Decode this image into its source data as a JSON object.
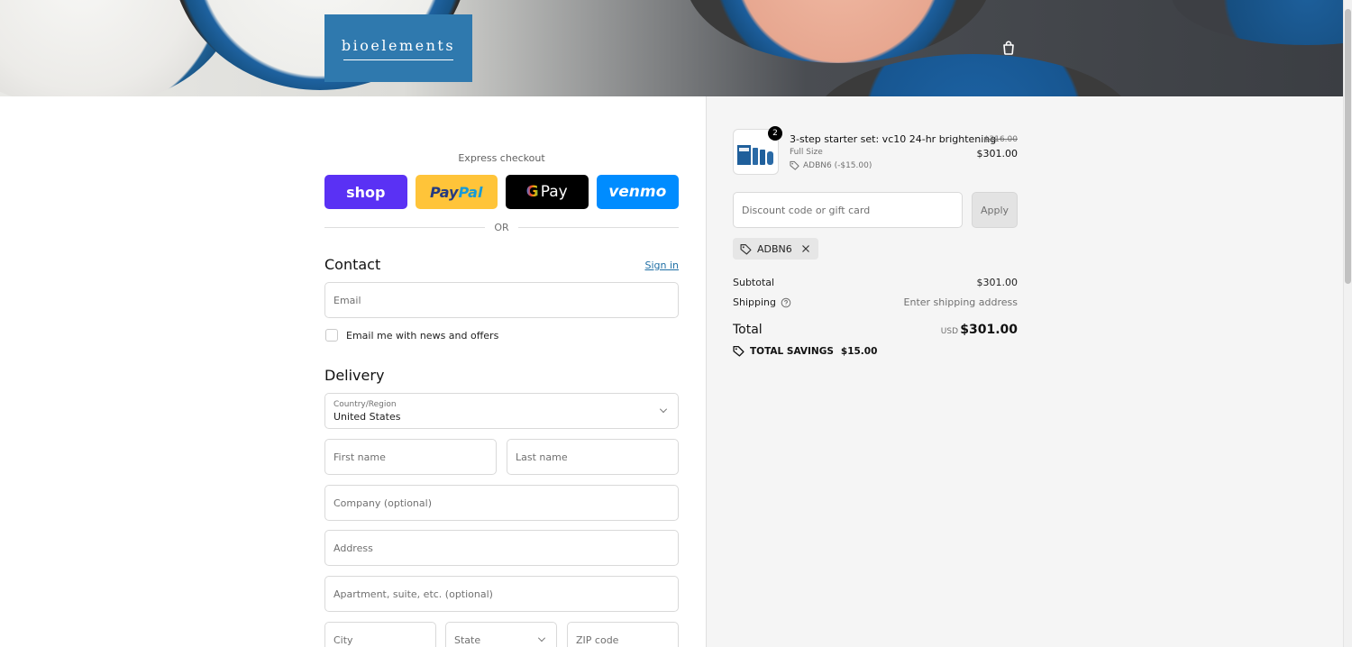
{
  "brand": {
    "logo_text": "bioelements"
  },
  "express": {
    "title": "Express checkout",
    "or_label": "OR",
    "buttons": {
      "shop": "shop",
      "paypal_pay": "Pay",
      "paypal_pal": "Pal",
      "gpay_g": "G",
      "gpay_pay": "Pay",
      "venmo": "venmo"
    }
  },
  "contact": {
    "title": "Contact",
    "signin_label": "Sign in",
    "email_placeholder": "Email",
    "newsletter_label": "Email me with news and offers"
  },
  "delivery": {
    "title": "Delivery",
    "country_label": "Country/Region",
    "country_value": "United States",
    "first_name_placeholder": "First name",
    "last_name_placeholder": "Last name",
    "company_placeholder": "Company (optional)",
    "address_placeholder": "Address",
    "apartment_placeholder": "Apartment, suite, etc. (optional)",
    "city_placeholder": "City",
    "state_label": "State",
    "zip_placeholder": "ZIP code"
  },
  "summary": {
    "item": {
      "quantity": "2",
      "name": "3-step starter set: vc10 24-hr brightening",
      "variant": "Full Size",
      "discount": "ADBN6 (-$15.00)",
      "original_price": "$316.00",
      "price": "$301.00"
    },
    "discount_placeholder": "Discount code or gift card",
    "apply_label": "Apply",
    "applied_code": "ADBN6",
    "subtotal_label": "Subtotal",
    "subtotal_value": "$301.00",
    "shipping_label": "Shipping",
    "shipping_value": "Enter shipping address",
    "total_label": "Total",
    "total_currency": "USD",
    "total_value": "$301.00",
    "savings_label": "TOTAL SAVINGS",
    "savings_value": "$15.00"
  },
  "colors": {
    "shop_pay": "#5a31f4",
    "paypal": "#ffc439",
    "venmo": "#008cff",
    "logo_bg": "#2f79ae",
    "link": "#1f6fa5"
  }
}
